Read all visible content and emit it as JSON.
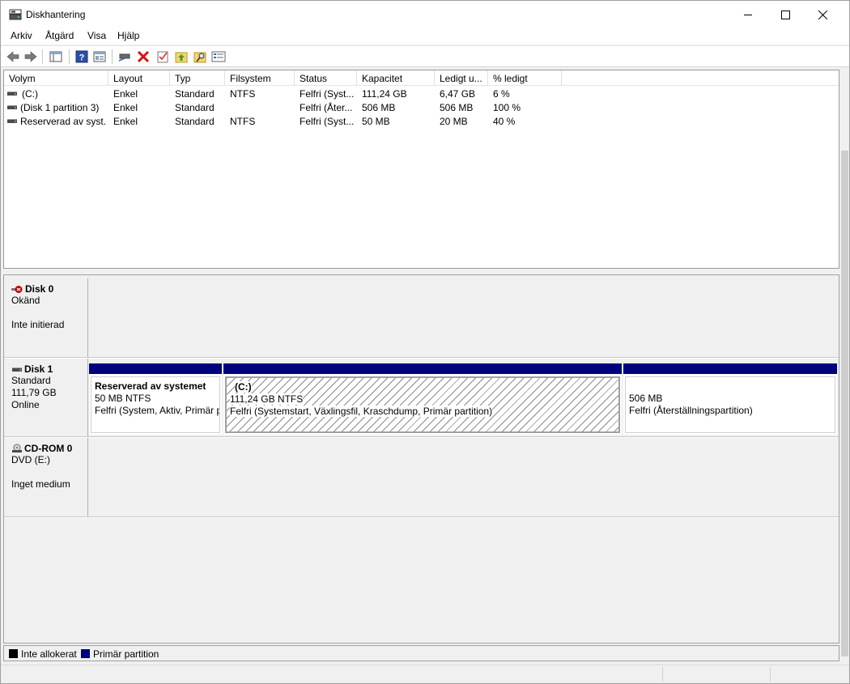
{
  "window": {
    "title": "Diskhantering"
  },
  "menu": [
    "Arkiv",
    "Åtgärd",
    "Visa",
    "Hjälp"
  ],
  "toolbar": {
    "icons": [
      "back-arrow-icon",
      "forward-arrow-icon",
      "console-tree-icon",
      "help-icon",
      "properties-icon",
      "connect-disk-icon",
      "delete-icon",
      "checklist-icon",
      "folder-up-icon",
      "search-folder-icon",
      "settings-list-icon"
    ]
  },
  "volume_list": {
    "columns": [
      "Volym",
      "Layout",
      "Typ",
      "Filsystem",
      "Status",
      "Kapacitet",
      "Ledigt u...",
      "% ledigt"
    ],
    "rows": [
      {
        "volym": "(C:)",
        "layout": "Enkel",
        "typ": "Standard",
        "filsystem": "NTFS",
        "status": "Felfri (Syst...",
        "kapacitet": "111,24 GB",
        "ledigt": "6,47 GB",
        "procent": "6 %"
      },
      {
        "volym": "(Disk 1 partition 3)",
        "layout": "Enkel",
        "typ": "Standard",
        "filsystem": "",
        "status": "Felfri (Åter...",
        "kapacitet": "506 MB",
        "ledigt": "506 MB",
        "procent": "100 %"
      },
      {
        "volym": "Reserverad av syst...",
        "layout": "Enkel",
        "typ": "Standard",
        "filsystem": "NTFS",
        "status": "Felfri (Syst...",
        "kapacitet": "50 MB",
        "ledigt": "20 MB",
        "procent": "40 %"
      }
    ]
  },
  "disks": {
    "disk0": {
      "name": "Disk 0",
      "line1": "Okänd",
      "line2": "",
      "line3": "Inte initierad"
    },
    "disk1": {
      "name": "Disk 1",
      "line1": "Standard",
      "line2": "111,79 GB",
      "line3": "Online"
    },
    "cdrom0": {
      "name": "CD-ROM 0",
      "line1": "DVD (E:)",
      "line2": "",
      "line3": "Inget medium"
    }
  },
  "partitions": {
    "reserved": {
      "name": "Reserverad av systemet",
      "size": "50 MB NTFS",
      "status": "Felfri (System, Aktiv, Primär partition)"
    },
    "c": {
      "name": "(C:)",
      "size": "111,24 GB NTFS",
      "status": "Felfri (Systemstart, Växlingsfil, Kraschdump, Primär partition)"
    },
    "recovery": {
      "name": "",
      "size": "506 MB",
      "status": "Felfri (Återställningspartition)"
    }
  },
  "legend": {
    "unallocated": {
      "label": "Inte allokerat",
      "color": "#000000"
    },
    "primary": {
      "label": "Primär partition",
      "color": "#00007e"
    }
  }
}
